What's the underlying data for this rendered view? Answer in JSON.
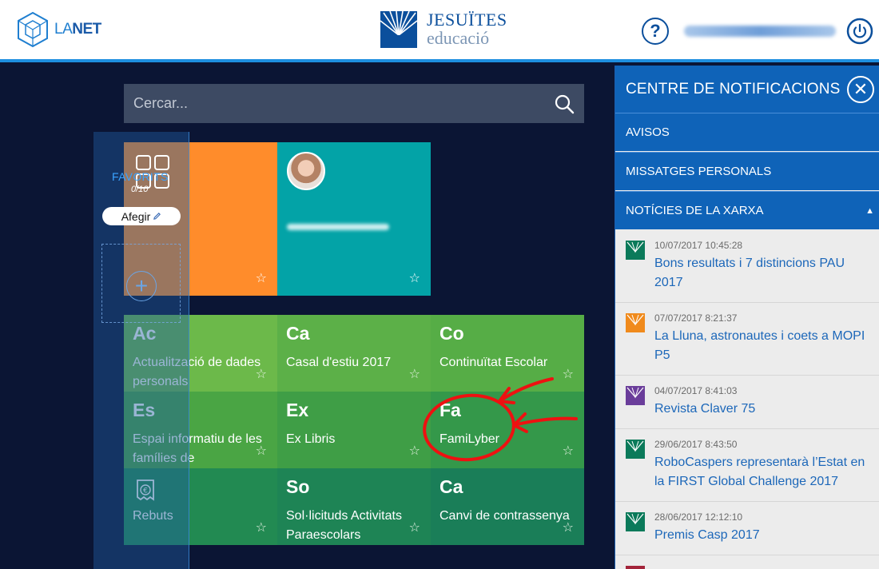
{
  "header": {
    "lanet_logo": {
      "prefix": "LA",
      "suffix": "NET"
    },
    "jesuites_logo": {
      "line1": "JESUÏTES",
      "line2": "educació"
    },
    "help_icon": "question-circle-icon",
    "power_icon": "power-icon"
  },
  "search": {
    "placeholder": "Cercar...",
    "icon": "search-icon"
  },
  "favorites": {
    "title": "FAVORITS",
    "count": "0/10",
    "add_label": "Afegir",
    "plus_icon": "plus-circle-icon"
  },
  "tiles": [
    {
      "abbr": "Ac",
      "name": "Actualització de dades personals",
      "color": "#6cb94a"
    },
    {
      "abbr": "Ca",
      "name": "Casal d'estiu 2017",
      "color": "#5cb048"
    },
    {
      "abbr": "Co",
      "name": "Continuïtat Escolar",
      "color": "#56ad46"
    },
    {
      "abbr": "Es",
      "name": "Espai informatiu de les famílies de",
      "color": "#4aa544"
    },
    {
      "abbr": "Ex",
      "name": "Ex Libris",
      "color": "#3f9e46"
    },
    {
      "abbr": "Fa",
      "name": "FamiLyber",
      "color": "#34984a"
    },
    {
      "abbr": "",
      "name": "Rebuts",
      "color": "#228a52"
    },
    {
      "abbr": "So",
      "name": "Sol·licituds Activitats Paraescolars",
      "color": "#1e8455"
    },
    {
      "abbr": "Ca",
      "name": "Canvi de contrassenya",
      "color": "#1a7e58"
    }
  ],
  "big_tiles": [
    {
      "color": "#ff8c2b"
    },
    {
      "color": "#03a3a7"
    }
  ],
  "notifications": {
    "title": "CENTRE DE NOTIFICACIONS",
    "sections": [
      "AVISOS",
      "MISSATGES PERSONALS",
      "NOTÍCIES DE LA XARXA"
    ],
    "news": [
      {
        "date": "10/07/2017 10:45:28",
        "title": "Bons resultats i 7 distincions PAU 2017",
        "color": "#0b7a5a"
      },
      {
        "date": "07/07/2017 8:21:37",
        "title": "La Lluna, astronautes i coets a MOPI P5",
        "color": "#f08a1c"
      },
      {
        "date": "04/07/2017 8:41:03",
        "title": "Revista Claver 75",
        "color": "#6a3d9a"
      },
      {
        "date": "29/06/2017 8:43:50",
        "title": "RoboCaspers representarà l’Estat en la FIRST Global Challenge 2017",
        "color": "#0b7a5a"
      },
      {
        "date": "28/06/2017 12:12:10",
        "title": "Premis Casp 2017",
        "color": "#0b7a5a"
      }
    ]
  }
}
